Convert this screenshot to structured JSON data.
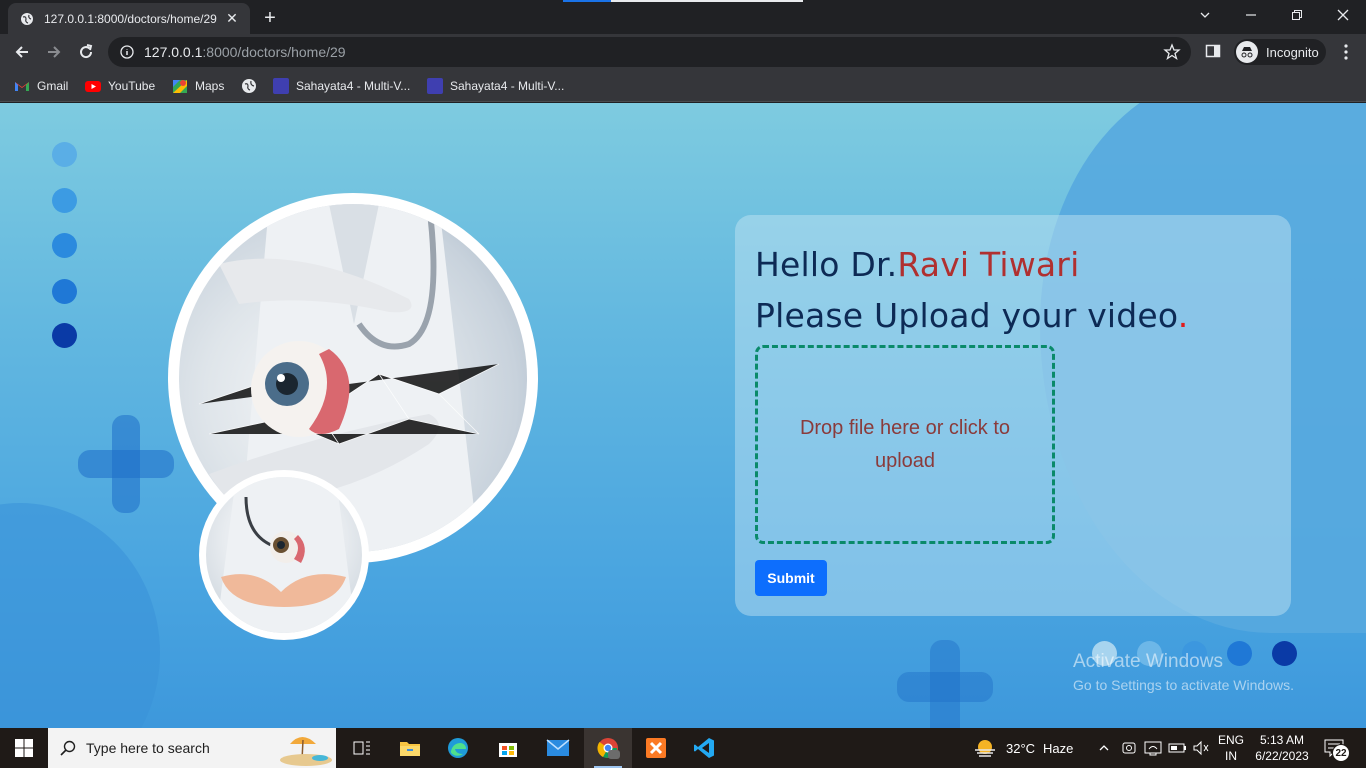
{
  "browser": {
    "tab_title": "127.0.0.1:8000/doctors/home/29",
    "url_host": "127.0.0.1",
    "url_path": ":8000/doctors/home/29",
    "profile_label": "Incognito",
    "new_tab_icon": "plus-icon"
  },
  "bookmarks": [
    {
      "label": "Gmail",
      "icon": "gmail-icon"
    },
    {
      "label": "YouTube",
      "icon": "youtube-icon"
    },
    {
      "label": "Maps",
      "icon": "maps-icon"
    },
    {
      "label": "",
      "icon": "globe-icon"
    },
    {
      "label": "Sahayata4 - Multi-V...",
      "icon": "sahayata-icon"
    },
    {
      "label": "Sahayata4 - Multi-V...",
      "icon": "sahayata-icon"
    }
  ],
  "main": {
    "greeting_prefix": "Hello Dr.",
    "doctor_name": "Ravi Tiwari",
    "upload_prompt": "Please Upload your video",
    "upload_prompt_dot": ".",
    "dropzone_text": "Drop file here or click to upload",
    "submit_label": "Submit"
  },
  "watermark": {
    "line1": "Activate Windows",
    "line2": "Go to Settings to activate Windows."
  },
  "taskbar": {
    "search_placeholder": "Type here to search",
    "weather_temp": "32°C",
    "weather_desc": "Haze",
    "lang_line1": "ENG",
    "lang_line2": "IN",
    "time": "5:13 AM",
    "date": "6/22/2023",
    "notification_count": "22"
  },
  "colors": {
    "accent_blue": "#0d6efd",
    "name_red": "#b03030",
    "heading_navy": "#0d2a55",
    "dropzone_border": "#0a8a6a"
  }
}
